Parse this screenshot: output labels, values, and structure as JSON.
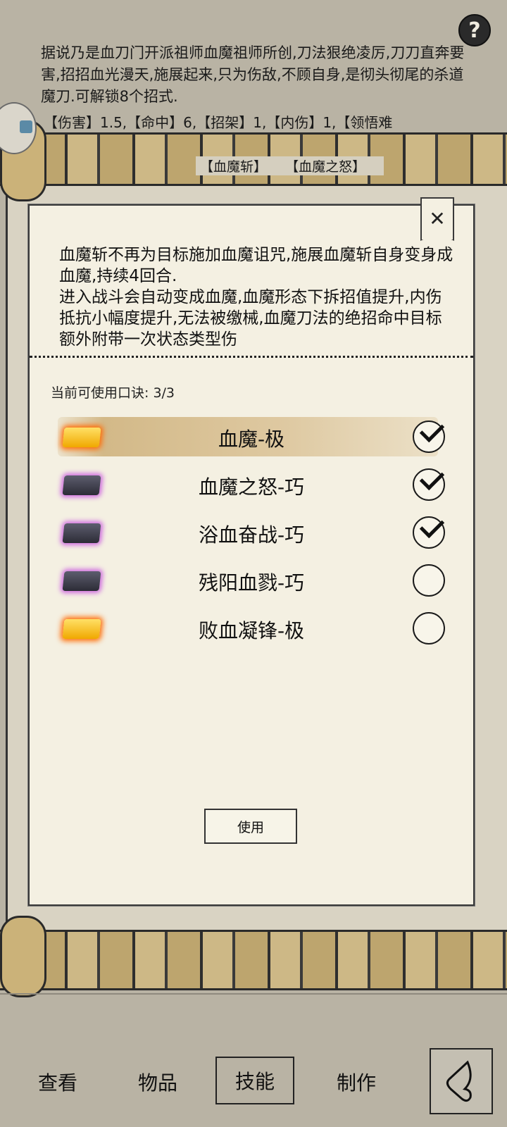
{
  "help": {
    "label": "?"
  },
  "background": {
    "description": "据说乃是血刀门开派祖师血魔祖师所创,刀法狠绝凌厉,刀刀直奔要害,招招血光漫天,施展起来,只为伤敌,不顾自身,是彻头彻尾的杀道魔刀.可解锁8个招式.",
    "stats": "【伤害】1.5,【命中】6,【招架】1,【内伤】1,【领悟难",
    "tabs": [
      "【血魔斩】",
      "【血魔之怒】"
    ]
  },
  "modal": {
    "description": "血魔斩不再为目标施加血魔诅咒,施展血魔斩自身变身成血魔,持续4回合.\n进入战斗会自动变成血魔,血魔形态下拆招值提升,内伤抵抗小幅度提升,无法被缴械,血魔刀法的绝招命中目标额外附带一次状态类型伤",
    "close_label": "✕",
    "mantra_count": "当前可使用口诀: 3/3",
    "mantras": [
      {
        "name": "血魔-极",
        "tier": "gold",
        "checked": true,
        "selected": true
      },
      {
        "name": "血魔之怒-巧",
        "tier": "purple",
        "checked": true,
        "selected": false
      },
      {
        "name": "浴血奋战-巧",
        "tier": "purple",
        "checked": true,
        "selected": false
      },
      {
        "name": "残阳血戮-巧",
        "tier": "purple",
        "checked": false,
        "selected": false
      },
      {
        "name": "败血凝锋-极",
        "tier": "gold",
        "checked": false,
        "selected": false
      }
    ],
    "use_label": "使用"
  },
  "nav": {
    "view": "查看",
    "items": "物品",
    "skills": "技能",
    "craft": "制作"
  }
}
